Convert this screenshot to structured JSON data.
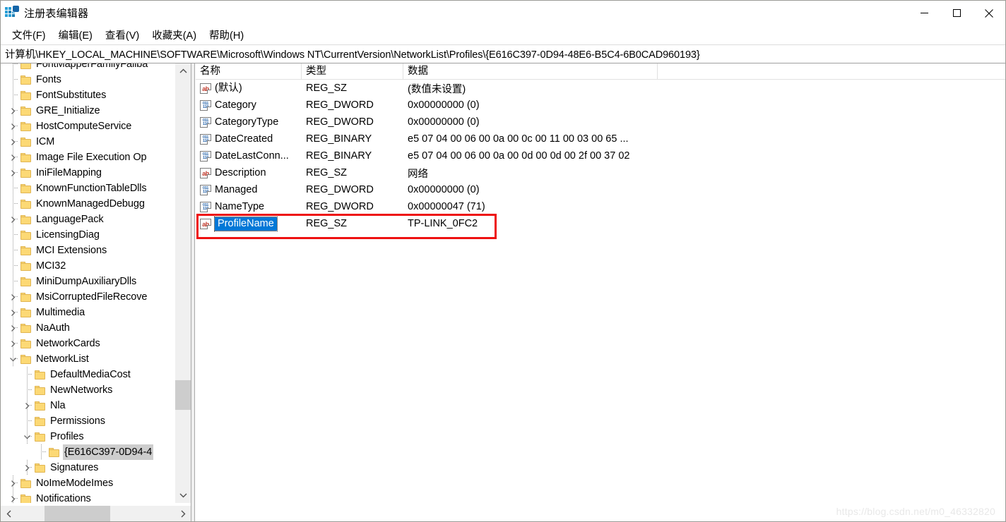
{
  "window": {
    "title": "注册表编辑器",
    "icon": "registry-editor-icon",
    "controls": [
      {
        "name": "minimize-button",
        "glyph": "minimize-icon"
      },
      {
        "name": "maximize-button",
        "glyph": "maximize-icon"
      },
      {
        "name": "close-button",
        "glyph": "close-icon"
      }
    ]
  },
  "menubar": {
    "items": [
      {
        "label": "文件(F)",
        "name": "menu-file"
      },
      {
        "label": "编辑(E)",
        "name": "menu-edit"
      },
      {
        "label": "查看(V)",
        "name": "menu-view"
      },
      {
        "label": "收藏夹(A)",
        "name": "menu-favorites"
      },
      {
        "label": "帮助(H)",
        "name": "menu-help"
      }
    ]
  },
  "addressbar": {
    "path": "计算机\\HKEY_LOCAL_MACHINE\\SOFTWARE\\Microsoft\\Windows NT\\CurrentVersion\\NetworkList\\Profiles\\{E616C397-0D94-48E6-B5C4-6B0CAD960193}"
  },
  "tree": {
    "nodes": [
      {
        "label": "FontMapperFamilyFallba",
        "indent": 1,
        "expander": "none",
        "selected": false
      },
      {
        "label": "Fonts",
        "indent": 1,
        "expander": "none",
        "selected": false
      },
      {
        "label": "FontSubstitutes",
        "indent": 1,
        "expander": "none",
        "selected": false
      },
      {
        "label": "GRE_Initialize",
        "indent": 1,
        "expander": "collapsed",
        "selected": false
      },
      {
        "label": "HostComputeService",
        "indent": 1,
        "expander": "collapsed",
        "selected": false
      },
      {
        "label": "ICM",
        "indent": 1,
        "expander": "collapsed",
        "selected": false
      },
      {
        "label": "Image File Execution Op",
        "indent": 1,
        "expander": "collapsed",
        "selected": false
      },
      {
        "label": "IniFileMapping",
        "indent": 1,
        "expander": "collapsed",
        "selected": false
      },
      {
        "label": "KnownFunctionTableDlls",
        "indent": 1,
        "expander": "none",
        "selected": false
      },
      {
        "label": "KnownManagedDebugg",
        "indent": 1,
        "expander": "none",
        "selected": false
      },
      {
        "label": "LanguagePack",
        "indent": 1,
        "expander": "collapsed",
        "selected": false
      },
      {
        "label": "LicensingDiag",
        "indent": 1,
        "expander": "none",
        "selected": false
      },
      {
        "label": "MCI Extensions",
        "indent": 1,
        "expander": "none",
        "selected": false
      },
      {
        "label": "MCI32",
        "indent": 1,
        "expander": "none",
        "selected": false
      },
      {
        "label": "MiniDumpAuxiliaryDlls",
        "indent": 1,
        "expander": "none",
        "selected": false
      },
      {
        "label": "MsiCorruptedFileRecove",
        "indent": 1,
        "expander": "collapsed",
        "selected": false
      },
      {
        "label": "Multimedia",
        "indent": 1,
        "expander": "collapsed",
        "selected": false
      },
      {
        "label": "NaAuth",
        "indent": 1,
        "expander": "collapsed",
        "selected": false
      },
      {
        "label": "NetworkCards",
        "indent": 1,
        "expander": "collapsed",
        "selected": false
      },
      {
        "label": "NetworkList",
        "indent": 1,
        "expander": "expanded",
        "selected": false
      },
      {
        "label": "DefaultMediaCost",
        "indent": 2,
        "expander": "none",
        "selected": false
      },
      {
        "label": "NewNetworks",
        "indent": 2,
        "expander": "none",
        "selected": false
      },
      {
        "label": "Nla",
        "indent": 2,
        "expander": "collapsed",
        "selected": false
      },
      {
        "label": "Permissions",
        "indent": 2,
        "expander": "none",
        "selected": false
      },
      {
        "label": "Profiles",
        "indent": 2,
        "expander": "expanded",
        "selected": false
      },
      {
        "label": "{E616C397-0D94-4",
        "indent": 3,
        "expander": "none",
        "selected": true
      },
      {
        "label": "Signatures",
        "indent": 2,
        "expander": "collapsed",
        "selected": false
      },
      {
        "label": "NoImeModeImes",
        "indent": 1,
        "expander": "collapsed",
        "selected": false
      },
      {
        "label": "Notifications",
        "indent": 1,
        "expander": "collapsed",
        "selected": false
      }
    ],
    "scroll_up_icon": "chevron-up-icon",
    "scroll_down_icon": "chevron-down-icon",
    "scroll_left_icon": "chevron-left-icon",
    "scroll_right_icon": "chevron-right-icon"
  },
  "list": {
    "columns": [
      {
        "label": "名称",
        "name": "column-name"
      },
      {
        "label": "类型",
        "name": "column-type"
      },
      {
        "label": "数据",
        "name": "column-data"
      }
    ],
    "rows": [
      {
        "name": "(默认)",
        "type": "REG_SZ",
        "data": "(数值未设置)",
        "icon": "string-value-icon",
        "selected": false
      },
      {
        "name": "Category",
        "type": "REG_DWORD",
        "data": "0x00000000 (0)",
        "icon": "binary-value-icon",
        "selected": false
      },
      {
        "name": "CategoryType",
        "type": "REG_DWORD",
        "data": "0x00000000 (0)",
        "icon": "binary-value-icon",
        "selected": false
      },
      {
        "name": "DateCreated",
        "type": "REG_BINARY",
        "data": "e5 07 04 00 06 00 0a 00 0c 00 11 00 03 00 65 ...",
        "icon": "binary-value-icon",
        "selected": false
      },
      {
        "name": "DateLastConn...",
        "type": "REG_BINARY",
        "data": "e5 07 04 00 06 00 0a 00 0d 00 0d 00 2f 00 37 02",
        "icon": "binary-value-icon",
        "selected": false
      },
      {
        "name": "Description",
        "type": "REG_SZ",
        "data": "网络",
        "icon": "string-value-icon",
        "selected": false
      },
      {
        "name": "Managed",
        "type": "REG_DWORD",
        "data": "0x00000000 (0)",
        "icon": "binary-value-icon",
        "selected": false
      },
      {
        "name": "NameType",
        "type": "REG_DWORD",
        "data": "0x00000047 (71)",
        "icon": "binary-value-icon",
        "selected": false
      },
      {
        "name": "ProfileName",
        "type": "REG_SZ",
        "data": "TP-LINK_0FC2",
        "icon": "string-value-icon",
        "selected": true
      }
    ]
  },
  "annotation": {
    "highlight_color": "#ee1111",
    "target_row": "ProfileName"
  },
  "watermark": {
    "text": "https://blog.csdn.net/m0_46332820"
  }
}
